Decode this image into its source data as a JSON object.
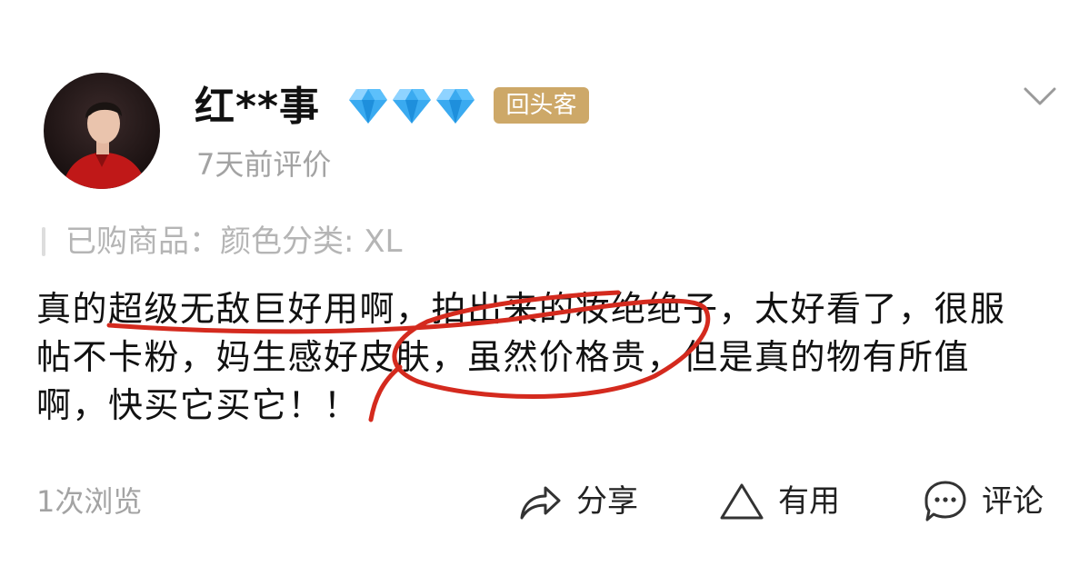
{
  "review": {
    "username": "红**事",
    "badge": "回头客",
    "time": "7天前评价",
    "purchased": "已购商品：颜色分类: XL",
    "text": "真的超级无敌巨好用啊，拍出来的妆绝绝子，太好看了，很服帖不卡粉，妈生感好皮肤，虽然价格贵，但是真的物有所值啊，快买它买它！！",
    "views": "1次浏览"
  },
  "actions": {
    "share": "分享",
    "useful": "有用",
    "comment": "评论"
  },
  "icons": {
    "avatar": "avatar-photo",
    "level": "diamond-icon",
    "expand": "chevron-down-icon",
    "share": "share-arrow-icon",
    "useful": "triangle-icon",
    "comment": "comment-bubble-icon"
  },
  "colors": {
    "badge": "#cda868",
    "diamond": "#3aaaf0",
    "annotation": "#d42a1e",
    "muted": "#a3a3a3"
  }
}
